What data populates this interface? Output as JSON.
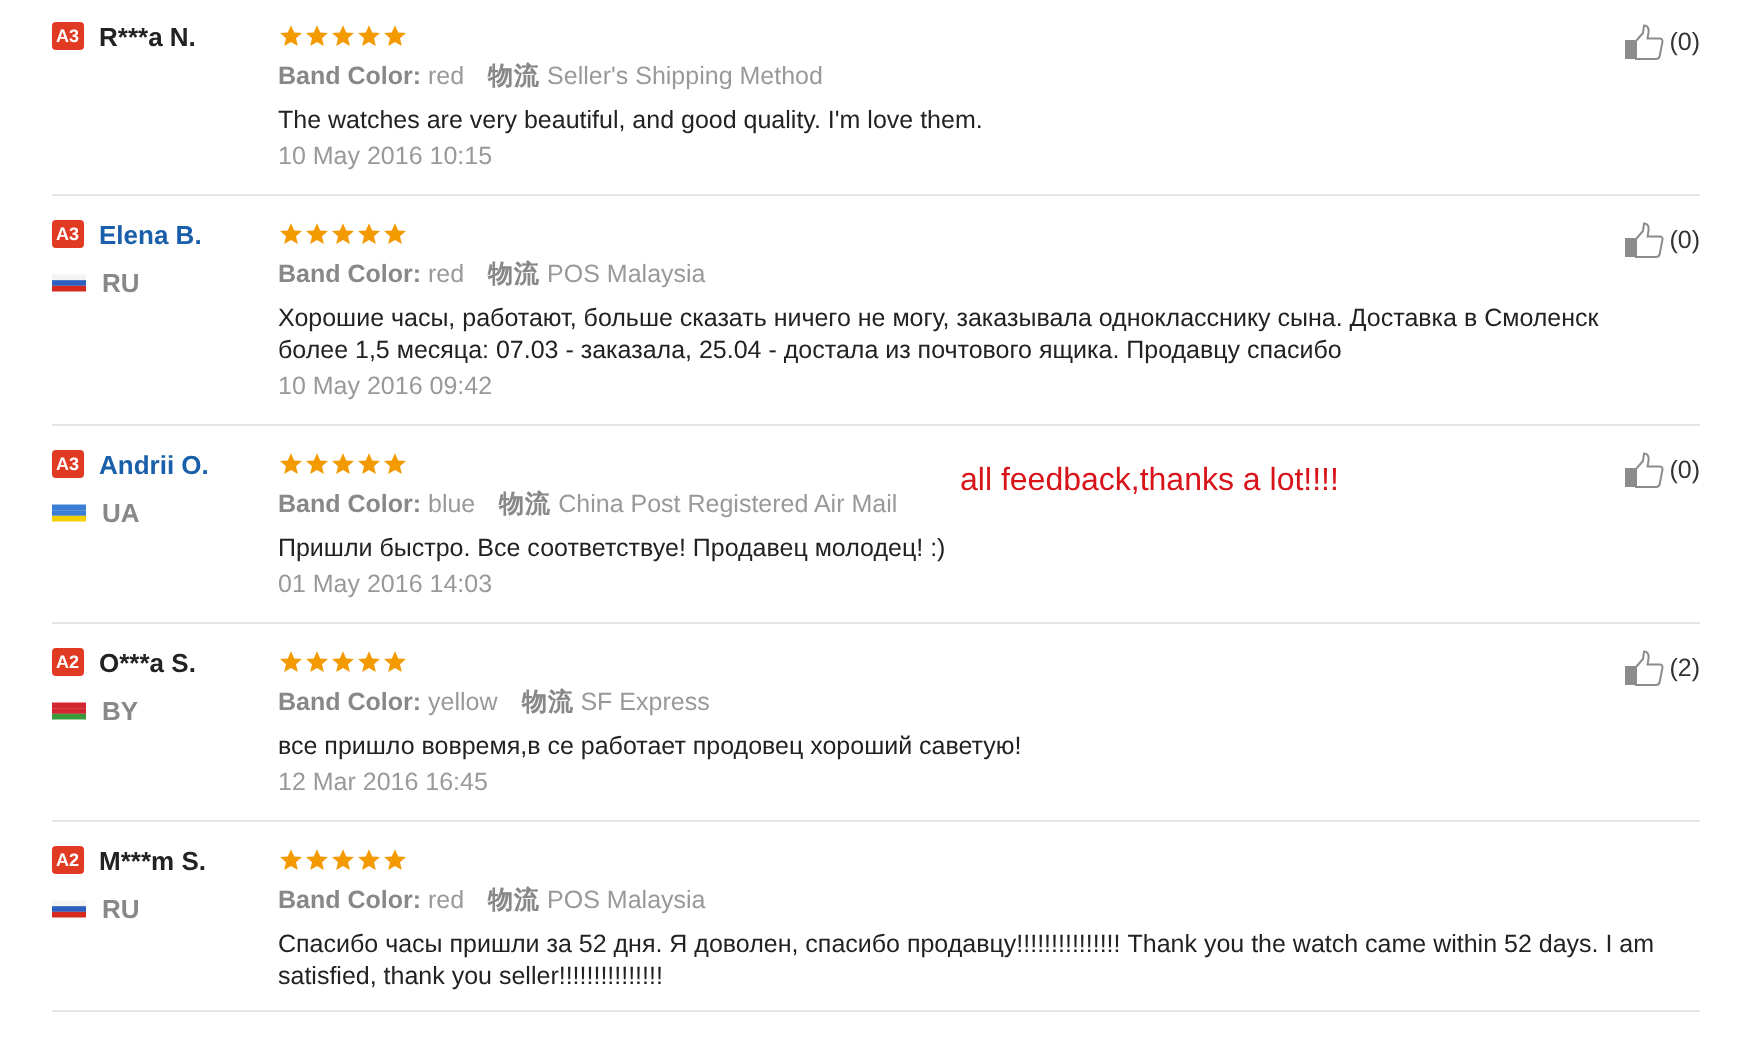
{
  "overlay_note": "all feedback,thanks a lot!!!!",
  "reviews": [
    {
      "name": "R***a N.",
      "name_link": false,
      "badge": "A3",
      "stars": 5,
      "band_label": "Band Color:",
      "band_color": "red",
      "shipping_label": "物流",
      "shipping": "Seller's Shipping Method",
      "text": "The watches are very beautiful, and good quality. I'm love them.",
      "date": "10 May 2016 10:15",
      "likes": "(0)"
    },
    {
      "name": "Elena B.",
      "name_link": true,
      "badge": "A3",
      "flag": {
        "kind": "ru"
      },
      "country": "RU",
      "stars": 5,
      "band_label": "Band Color:",
      "band_color": "red",
      "shipping_label": "物流",
      "shipping": "POS Malaysia",
      "text": "Хорошие часы, работают, больше сказать ничего не могу, заказывала однокласснику сына. Доставка в Смоленск более 1,5 месяца: 07.03 - заказала, 25.04 - достала из почтового ящика. Продавцу спасибо",
      "date": "10 May 2016 09:42",
      "likes": "(0)"
    },
    {
      "name": "Andrii O.",
      "name_link": true,
      "badge": "A3",
      "flag": {
        "kind": "ua"
      },
      "country": "UA",
      "stars": 5,
      "band_label": "Band Color:",
      "band_color": "blue",
      "shipping_label": "物流",
      "shipping": "China Post Registered Air Mail",
      "text": "Пришли быстро. Все соответствуе! Продавец молодец! :)",
      "date": "01 May 2016 14:03",
      "likes": "(0)"
    },
    {
      "name": "O***a S.",
      "name_link": false,
      "badge": "A2",
      "flag": {
        "kind": "by"
      },
      "country": "BY",
      "stars": 5,
      "band_label": "Band Color:",
      "band_color": "yellow",
      "shipping_label": "物流",
      "shipping": "SF Express",
      "text": "все пришло вовремя,в се работает продовец хороший саветую!",
      "date": "12 Mar 2016 16:45",
      "likes": "(2)"
    },
    {
      "name": "M***m S.",
      "name_link": false,
      "badge": "A2",
      "flag": {
        "kind": "ru"
      },
      "country": "RU",
      "stars": 5,
      "band_label": "Band Color:",
      "band_color": "red",
      "shipping_label": "物流",
      "shipping": "POS Malaysia",
      "text": "Спасибо часы пришли за 52 дня. Я доволен, спасибо продавцу!!!!!!!!!!!!!!! Thank you the watch came within 52 days. I am satisfied, thank you seller!!!!!!!!!!!!!!!"
    }
  ]
}
